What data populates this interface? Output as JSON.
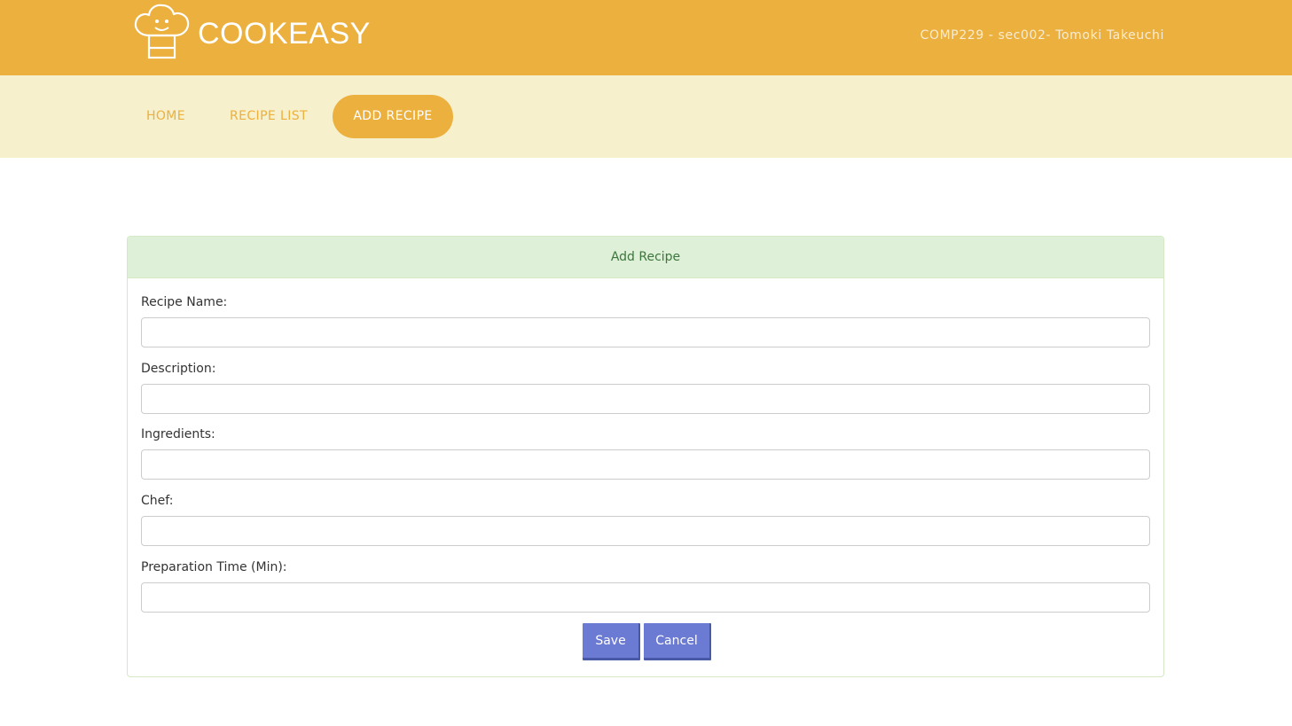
{
  "header": {
    "brand": "COOKEASY",
    "author": "COMP229 - sec002- Tomoki Takeuchi",
    "logo_icon": "chef-hat-icon"
  },
  "nav": {
    "items": [
      {
        "label": "HOME",
        "active": false
      },
      {
        "label": "RECIPE LIST",
        "active": false
      },
      {
        "label": "ADD RECIPE",
        "active": true
      }
    ]
  },
  "form": {
    "title": "Add Recipe",
    "fields": [
      {
        "label": "Recipe Name:",
        "value": "",
        "placeholder": ""
      },
      {
        "label": "Description:",
        "value": "",
        "placeholder": ""
      },
      {
        "label": "Ingredients:",
        "value": "",
        "placeholder": ""
      },
      {
        "label": "Chef:",
        "value": "",
        "placeholder": ""
      },
      {
        "label": "Preparation Time (Min):",
        "value": "",
        "placeholder": ""
      }
    ],
    "save_label": "Save",
    "cancel_label": "Cancel"
  },
  "colors": {
    "header_bg": "#ecb03e",
    "nav_bg": "#f6f0cc",
    "panel_heading_bg": "#dff0d8",
    "panel_heading_text": "#3c763d",
    "button_bg": "#6b7ad2"
  }
}
